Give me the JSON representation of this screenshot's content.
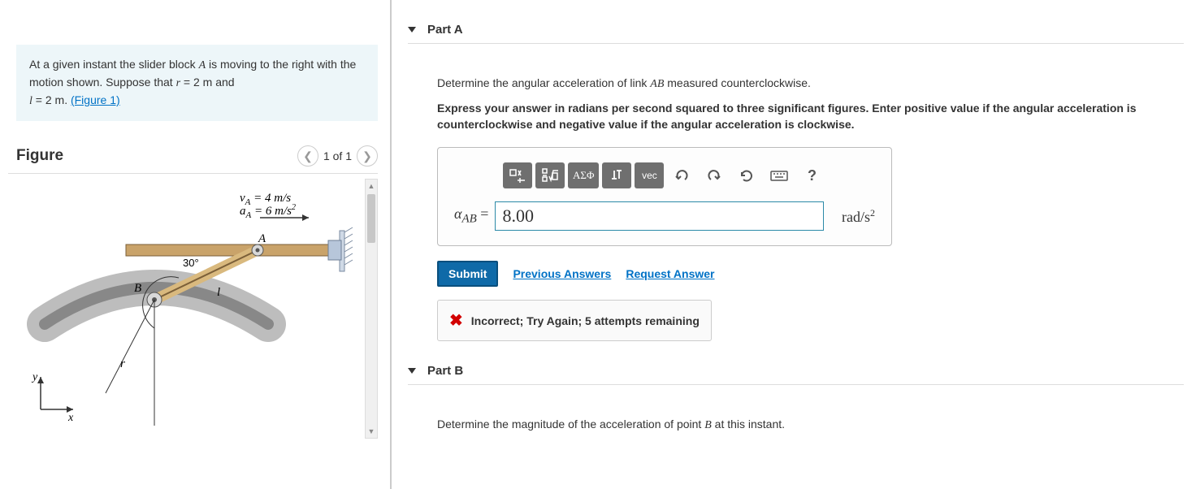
{
  "problem": {
    "desc_pre": "At a given instant the slider block ",
    "var_A": "A",
    "desc_mid1": " is moving to the right with the motion shown. Suppose that ",
    "var_r": "r",
    "desc_rval": " = 2 m",
    "desc_and": " and ",
    "var_l": "l",
    "desc_lval": " = 2 m",
    "desc_period": ". ",
    "fig_link": "(Figure 1)"
  },
  "figure": {
    "title": "Figure",
    "pager": "1 of 1",
    "labels": {
      "vel": "v",
      "velSub": "A",
      "velVal": " = 4 m/s",
      "acc": "a",
      "accSub": "A",
      "accVal": " = 6 m/s",
      "angle": "30°",
      "B": "B",
      "l": "l",
      "A": "A",
      "r": "r",
      "x": "x",
      "y": "y"
    }
  },
  "partA": {
    "header": "Part A",
    "q_pre": "Determine the angular acceleration of link ",
    "q_var": "AB",
    "q_post": " measured counterclockwise.",
    "hint": "Express your answer in radians per second squared to three significant figures. Enter positive value if the angular acceleration is counterclockwise and negative value if the angular acceleration is clockwise.",
    "toolbar": {
      "greek": "ΑΣΦ",
      "vec": "vec",
      "help": "?"
    },
    "lhs_sym": "α",
    "lhs_sub": "AB",
    "lhs_eq": " = ",
    "value": "8.00",
    "unit_base": "rad/s",
    "unit_sup": "2",
    "submit": "Submit",
    "prev": "Previous Answers",
    "req": "Request Answer",
    "feedback": "Incorrect; Try Again; 5 attempts remaining"
  },
  "partB": {
    "header": "Part B",
    "q_pre": "Determine the magnitude of the acceleration of point ",
    "q_var": "B",
    "q_post": " at this instant."
  }
}
